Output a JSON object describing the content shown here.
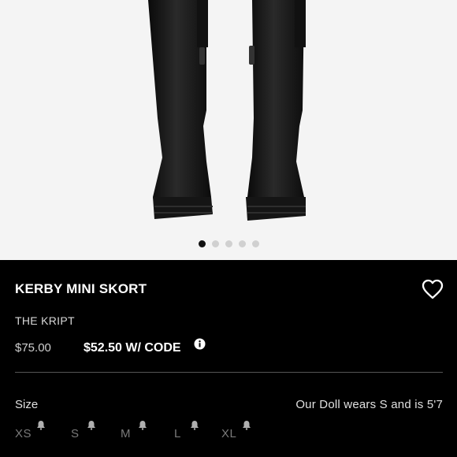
{
  "carousel": {
    "image_icon": "product-photo-black-knee-high-boots",
    "dots_total": 5,
    "active_dot": 0
  },
  "product": {
    "title": "KERBY MINI SKORT",
    "brand": "THE KRIPT",
    "original_price": "$75.00",
    "sale_price": "$52.50 W/ CODE",
    "wishlist_icon": "heart-outline-icon",
    "info_icon": "info-icon"
  },
  "size_section": {
    "label": "Size",
    "fit_note": "Our Doll wears S and is 5'7",
    "options": [
      {
        "label": "XS",
        "icon": "bell-icon"
      },
      {
        "label": "S",
        "icon": "bell-icon"
      },
      {
        "label": "M",
        "icon": "bell-icon"
      },
      {
        "label": "L",
        "icon": "bell-icon"
      },
      {
        "label": "XL",
        "icon": "bell-icon"
      }
    ]
  },
  "colors": {
    "panel_bg": "#000000",
    "image_bg": "#f4f4f4",
    "muted_text": "#7a7a7a"
  }
}
